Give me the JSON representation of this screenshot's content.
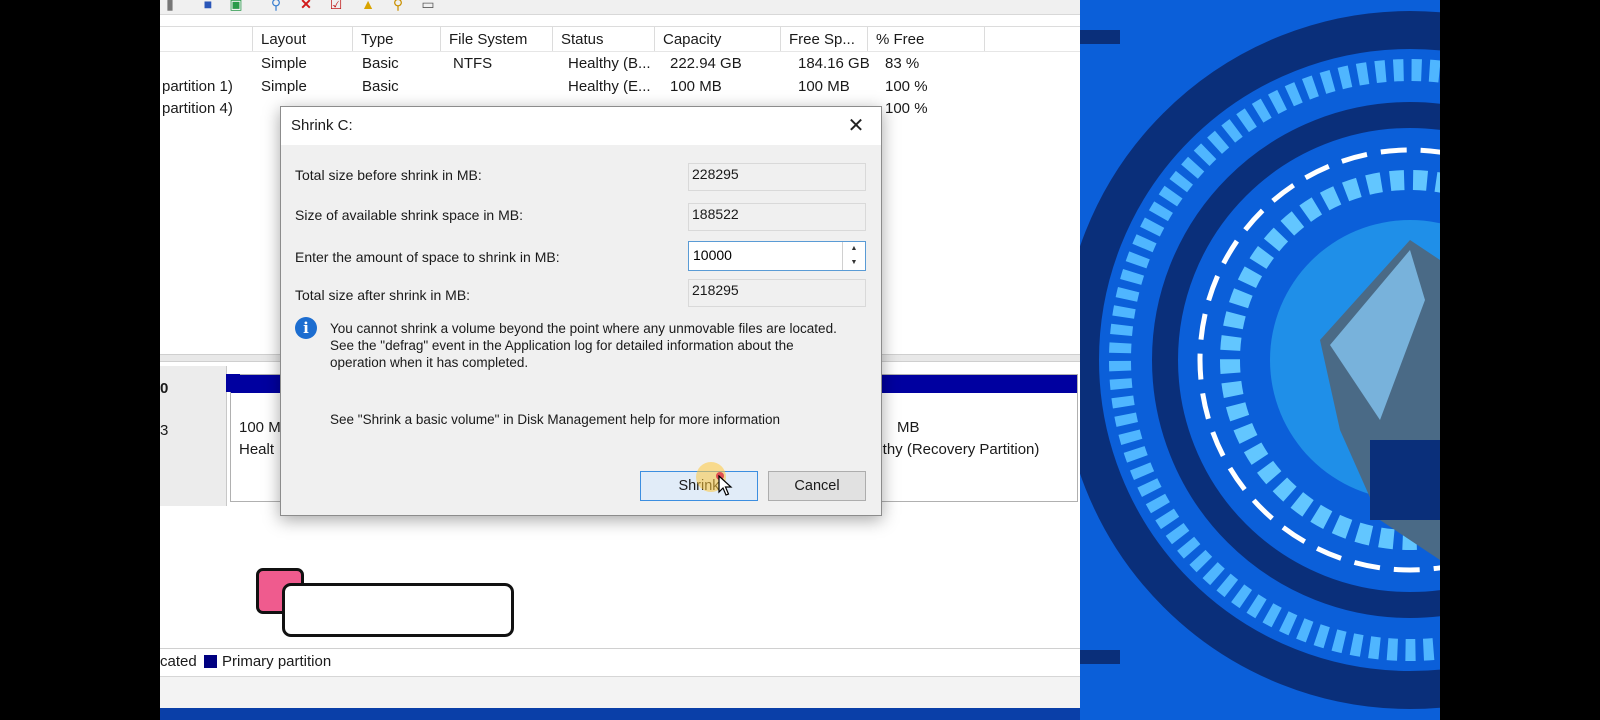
{
  "columns": [
    "Layout",
    "Type",
    "File System",
    "Status",
    "Capacity",
    "Free Sp...",
    "% Free"
  ],
  "volumes": [
    {
      "name": "",
      "layout": "Simple",
      "type": "Basic",
      "fs": "NTFS",
      "status": "Healthy (B...",
      "capacity": "222.94 GB",
      "free": "184.16 GB",
      "pct": "83 %"
    },
    {
      "name": "partition 1)",
      "layout": "Simple",
      "type": "Basic",
      "fs": "",
      "status": "Healthy (E...",
      "capacity": "100 MB",
      "free": "100 MB",
      "pct": "100 %"
    },
    {
      "name": "partition 4)",
      "layout": "",
      "type": "",
      "fs": "",
      "status": "",
      "capacity": "",
      "free": "",
      "pct": "100 %"
    }
  ],
  "disk": {
    "label_top": "0",
    "label_mid": "3",
    "partition1_size": "100 M",
    "partition1_status": "Healt",
    "partition3_size": "MB",
    "partition3_status": "althy (Recovery Partition)"
  },
  "legend": {
    "unallocated": "cated",
    "primary": "Primary partition"
  },
  "dialog": {
    "title": "Shrink C:",
    "close_glyph": "✕",
    "total_before_label": "Total size before shrink in MB:",
    "total_before_value": "228295",
    "available_label": "Size of available shrink space in MB:",
    "available_value": "188522",
    "amount_label": "Enter the amount of space to shrink in MB:",
    "amount_value": "10000",
    "total_after_label": "Total size after shrink in MB:",
    "total_after_value": "218295",
    "info_line1": "You cannot shrink a volume beyond the point where any unmovable files are located.",
    "info_line2": "See the \"defrag\" event in the Application log for detailed information about the",
    "info_line3": "operation when it has completed.",
    "help_text": "See \"Shrink a basic volume\" in Disk Management help for more information",
    "shrink_button": "Shrink",
    "cancel_button": "Cancel"
  },
  "colors": {
    "primary_partition": "#000080",
    "dialog_accent": "#3c8ee0",
    "wallpaper": "#0b5fd9",
    "pink_tag": "#ef5b8e"
  },
  "icons": {
    "info": "info-icon",
    "close": "close-icon",
    "spin_up": "chevron-up-icon",
    "spin_down": "chevron-down-icon",
    "cursor": "mouse-pointer-icon"
  }
}
